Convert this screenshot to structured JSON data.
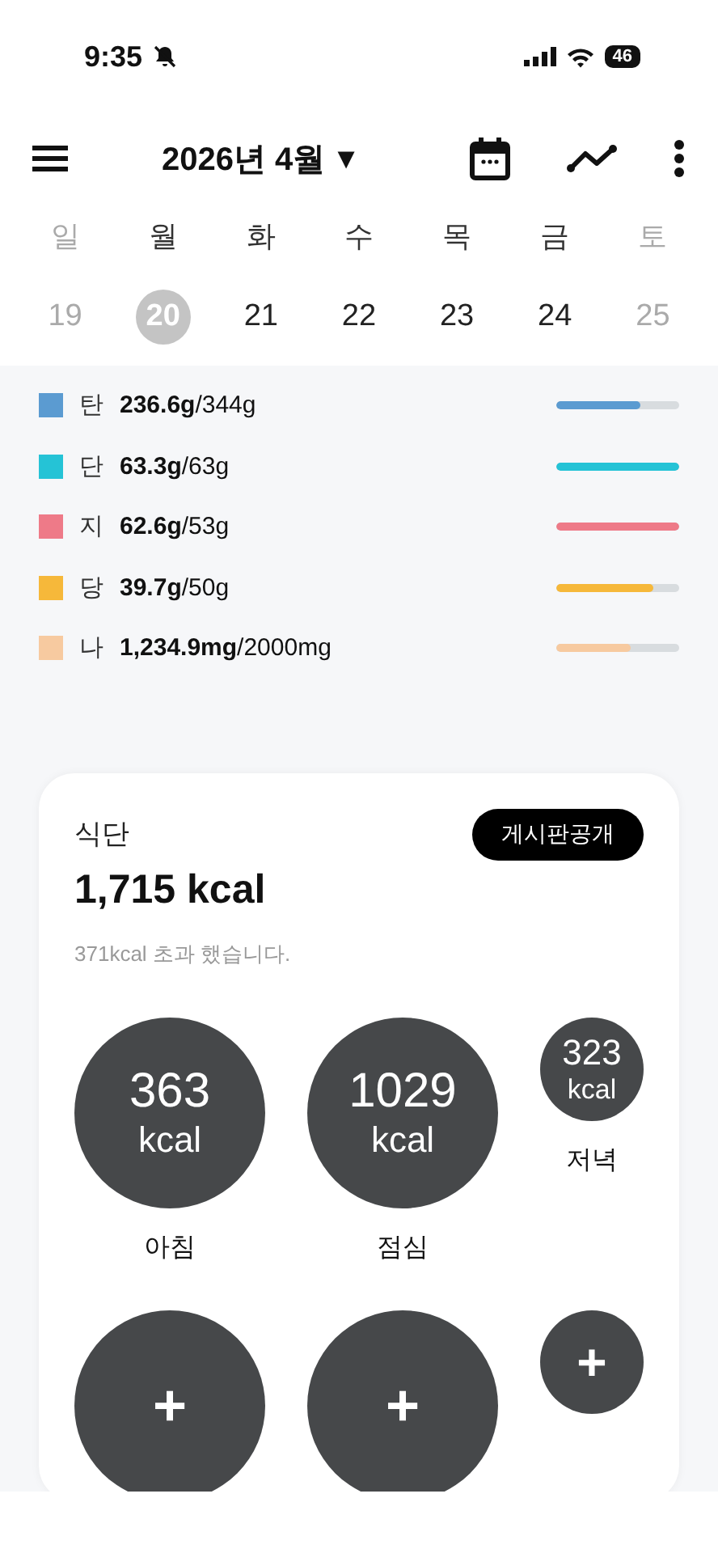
{
  "status_bar": {
    "time": "9:35",
    "battery": "46"
  },
  "header": {
    "title": "2026년 4월",
    "dropdown": "▼"
  },
  "week": {
    "days": [
      {
        "weekday": "일",
        "date": "19",
        "kind": "weekend",
        "selected": false
      },
      {
        "weekday": "월",
        "date": "20",
        "kind": "weekday",
        "selected": true
      },
      {
        "weekday": "화",
        "date": "21",
        "kind": "weekday",
        "selected": false
      },
      {
        "weekday": "수",
        "date": "22",
        "kind": "weekday",
        "selected": false
      },
      {
        "weekday": "목",
        "date": "23",
        "kind": "weekday",
        "selected": false
      },
      {
        "weekday": "금",
        "date": "24",
        "kind": "weekday",
        "selected": false
      },
      {
        "weekday": "토",
        "date": "25",
        "kind": "weekend",
        "selected": false
      }
    ]
  },
  "nutrients": [
    {
      "label": "탄",
      "amount": "236.6g",
      "goal": "/344g",
      "color": "#5b9bd1",
      "level": 0.69
    },
    {
      "label": "단",
      "amount": "63.3g",
      "goal": "/63g",
      "color": "#25c3d6",
      "level": 1
    },
    {
      "label": "지",
      "amount": "62.6g",
      "goal": "/53g",
      "color": "#ee7a88",
      "level": 1
    },
    {
      "label": "당",
      "amount": "39.7g",
      "goal": "/50g",
      "color": "#f6b83a",
      "level": 0.79
    },
    {
      "label": "나",
      "amount": "1,234.9mg",
      "goal": "/2000mg",
      "color": "#f7caa0",
      "level": 0.61
    }
  ],
  "diet": {
    "title": "식단",
    "share_button": "게시판공개",
    "total": "1,715 kcal",
    "note": "371kcal 초과 했습니다.",
    "meals": [
      {
        "kind": "large",
        "value": "363",
        "unit": "kcal",
        "label": "아침"
      },
      {
        "kind": "large",
        "value": "1029",
        "unit": "kcal",
        "label": "점심"
      },
      {
        "kind": "small",
        "value": "323",
        "unit": "kcal",
        "label": "저녁"
      }
    ],
    "add_buttons": [
      {
        "kind": "large",
        "symbol": "+"
      },
      {
        "kind": "large",
        "symbol": "+"
      },
      {
        "kind": "small",
        "symbol": "+"
      }
    ]
  }
}
